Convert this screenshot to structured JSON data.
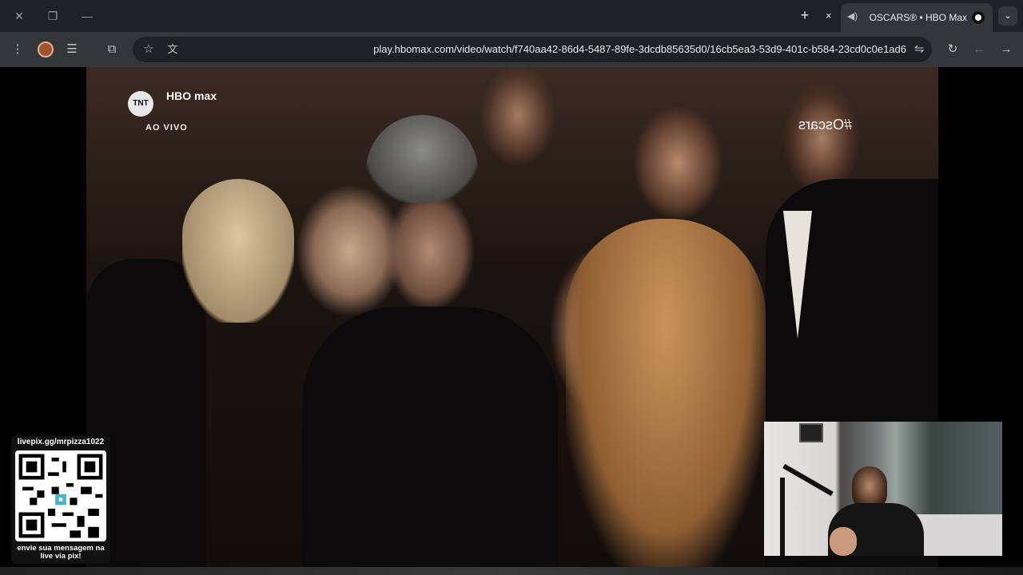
{
  "browser": {
    "tab": {
      "title": "OSCARS® • HBO Max",
      "close_glyph": "×"
    },
    "new_tab_glyph": "+",
    "url": "play.hbomax.com/video/watch/f740aa42-86d4-5487-89fe-3dcdb85635d0/16cb5ea3-53d9-401c-b584-23cd0c0e1ad6"
  },
  "video": {
    "brand_logo": "HBO max",
    "tnt_logo": "TNT",
    "live_label": "AO VIVO",
    "hashtag": "#Oscars"
  },
  "overlay": {
    "qr_top_text": "livepix.gg/mrpizza1022",
    "qr_bottom_line1": "envie sua mensagem na",
    "qr_bottom_line2": "live via pix!"
  },
  "colors": {
    "tabstrip_bg": "#202124",
    "toolbar_bg": "#35363a",
    "omnibox_bg": "#202124"
  },
  "icons": [
    "close-icon",
    "restore-icon",
    "minimize-icon",
    "new-tab-icon",
    "audio-icon",
    "hbo-favicon",
    "tab-search-icon",
    "menu-icon",
    "profile-avatar",
    "reading-list-icon",
    "extensions-icon",
    "bookmark-star-icon",
    "translate-icon",
    "site-settings-icon",
    "reload-icon",
    "back-icon",
    "forward-icon"
  ]
}
